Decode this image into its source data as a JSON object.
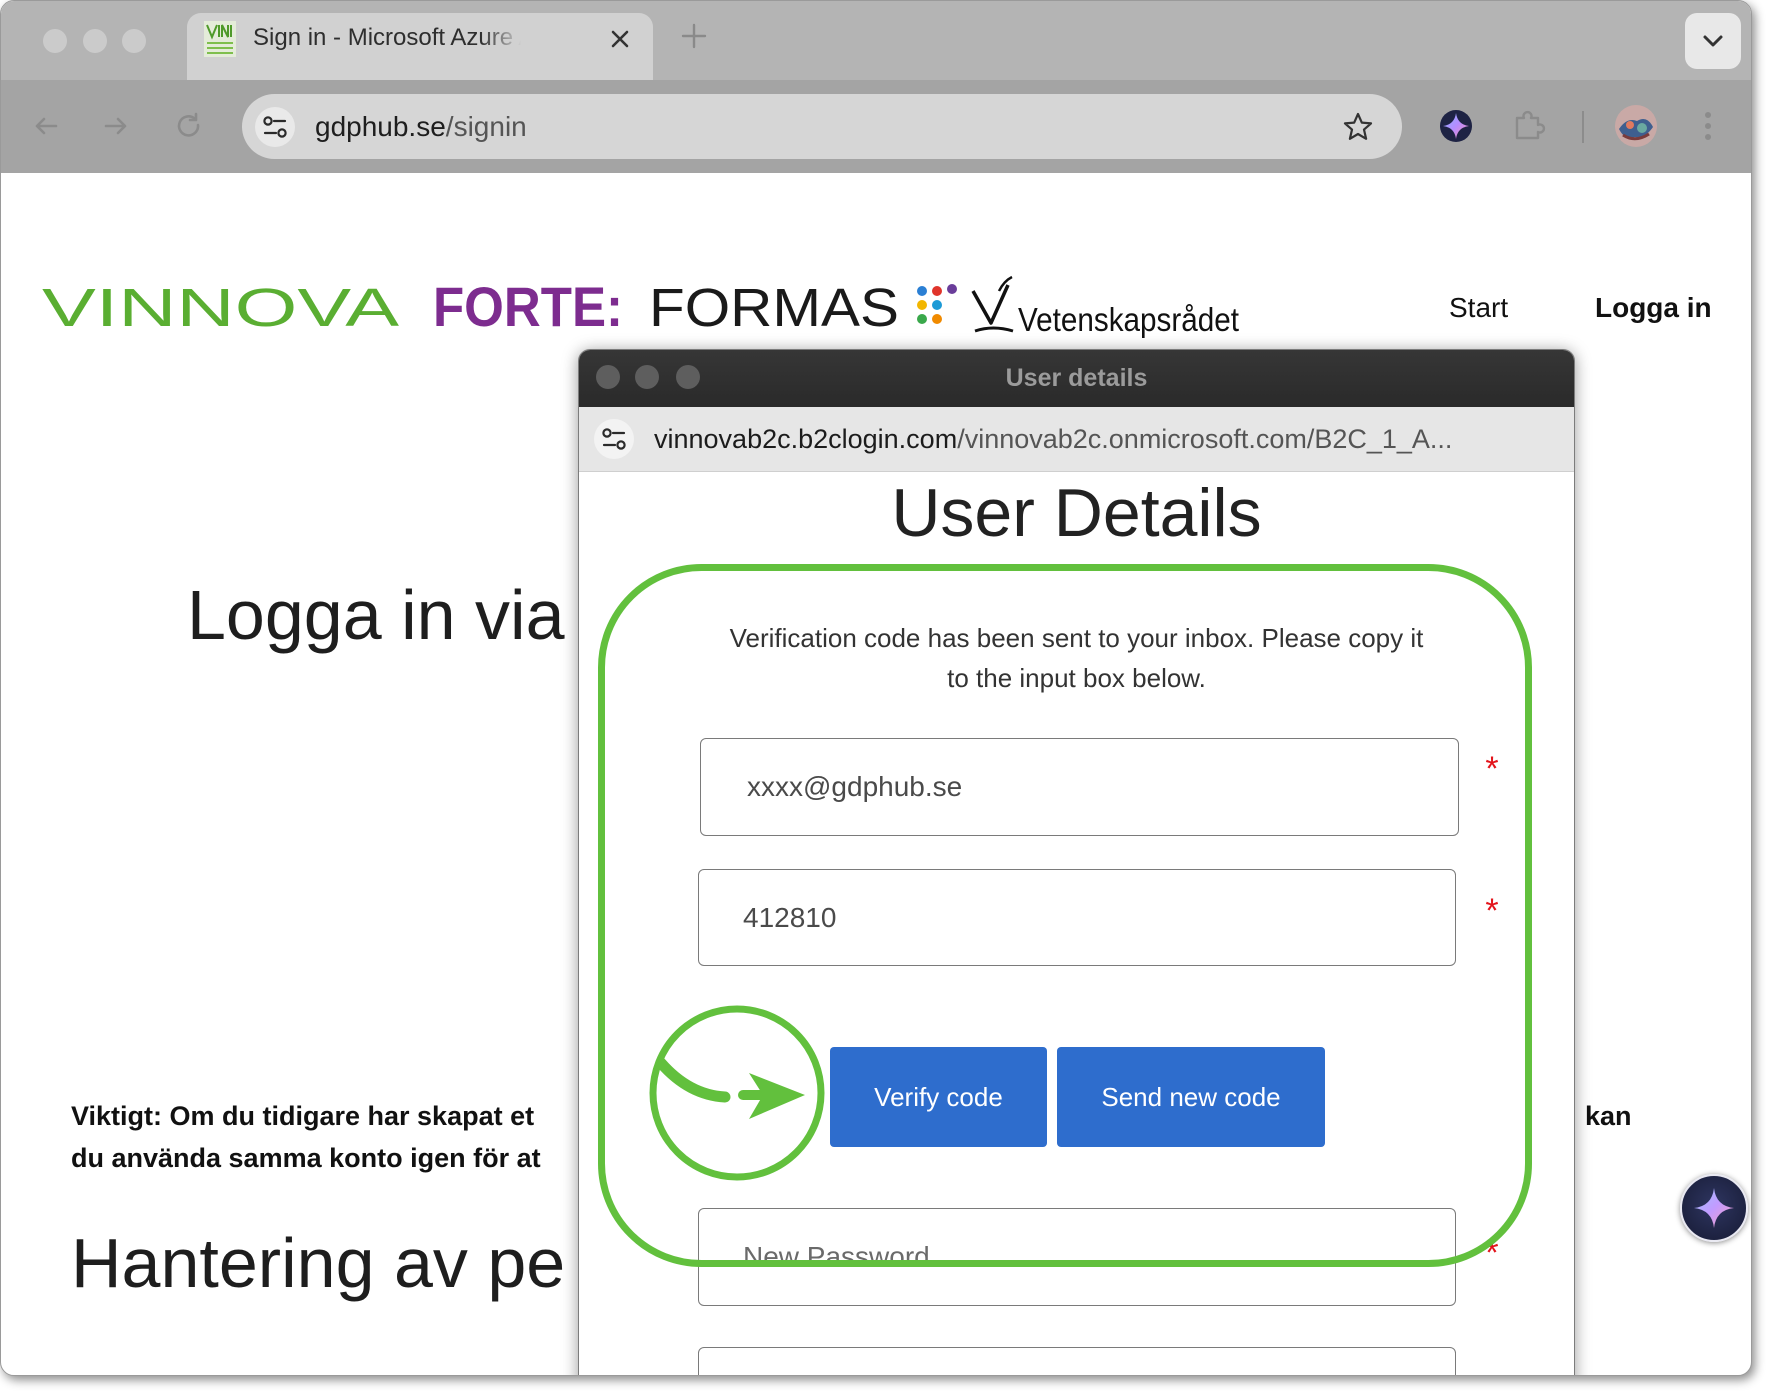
{
  "browser": {
    "tab_title": "Sign in - Microsoft Azure API",
    "address": {
      "domain": "gdphub.se",
      "path": "/signin"
    }
  },
  "site": {
    "logos": {
      "vinnova": "VINNOVA",
      "forte": "FORTE:",
      "formas": "FORMAS",
      "vr": "Vetenskapsrådet"
    },
    "nav": {
      "start": "Start",
      "login": "Logga in"
    },
    "heading": "Logga in via",
    "notice": {
      "line1": "Viktigt: Om du tidigare har skapat et",
      "line2": "du använda samma konto igen för at",
      "trailing": "kan"
    },
    "section_heading": "Hantering av pe"
  },
  "popup": {
    "window_title": "User details",
    "address": {
      "domain": "vinnovab2c.b2clogin.com",
      "path": "/vinnovab2c.onmicrosoft.com/B2C_1_A..."
    },
    "heading": "User Details",
    "message": {
      "line1": "Verification code has been sent to your inbox. Please copy it",
      "line2": "to the input box below."
    },
    "email": {
      "value": "xxxx@gdphub.se"
    },
    "verification_code": {
      "value": "412810"
    },
    "new_password": {
      "placeholder": "New Password"
    },
    "required_marker": "*",
    "buttons": {
      "verify": "Verify code",
      "send_new": "Send new code"
    }
  },
  "icons": [
    "back-arrow-icon",
    "forward-arrow-icon",
    "reload-icon",
    "site-info-icon",
    "bookmark-star-icon",
    "gemini-icon",
    "extensions-puzzle-icon",
    "profile-avatar",
    "more-menu-icon",
    "close-icon",
    "chevron-down-icon",
    "plus-icon"
  ],
  "colors": {
    "vinnova_green": "#5aae32",
    "forte_purple": "#7d2c8f",
    "button_blue": "#2e6dcd",
    "annotation_green": "#62c03d",
    "required_red": "#e3141b"
  }
}
